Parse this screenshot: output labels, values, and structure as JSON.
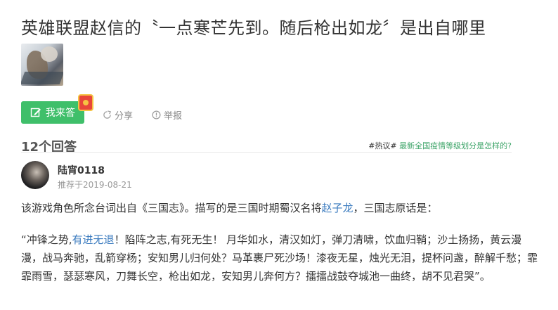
{
  "question": {
    "title": "英雄联盟赵信的〝一点寒芒先到。随后枪出如龙〞是出自哪里"
  },
  "actions": {
    "answer_label": "我来答",
    "share_label": "分享",
    "report_label": "举报"
  },
  "answers_header": {
    "count": "12个回答",
    "hot_tag": "#热议#",
    "hot_link": "最新全国疫情等级划分是怎样的?"
  },
  "answer": {
    "username": "陆宵0118",
    "recommend": "推荐于2019-08-21",
    "para1_a": "该游戏角色所念台词出自《三国志》。描写的是三国时期蜀汉名将",
    "para1_link": "赵子龙",
    "para1_b": "，三国志原话是：",
    "para2_a": "“冲锋之势,",
    "para2_link": "有进无退",
    "para2_b": "！陷阵之志,有死无生！ 月华如水，清汉如灯，弹刀清啸，饮血归鞘；沙土扬扬，黄云漫漫，战马奔驰，乱箭穿杨；安知男儿归何处？马革裹尸死沙场！漆夜无星，烛光无泪，提杯问盏，醉解千愁；霏霏雨雪，瑟瑟寒风，刀舞长空，枪出如龙，安知男儿奔何方？擂擂战鼓夺城池一曲终，胡不见君哭”。"
  },
  "colors": {
    "accent_green": "#3fbf6a",
    "link_blue": "#3b7bbf",
    "hot_link_green": "#3fa56a"
  }
}
